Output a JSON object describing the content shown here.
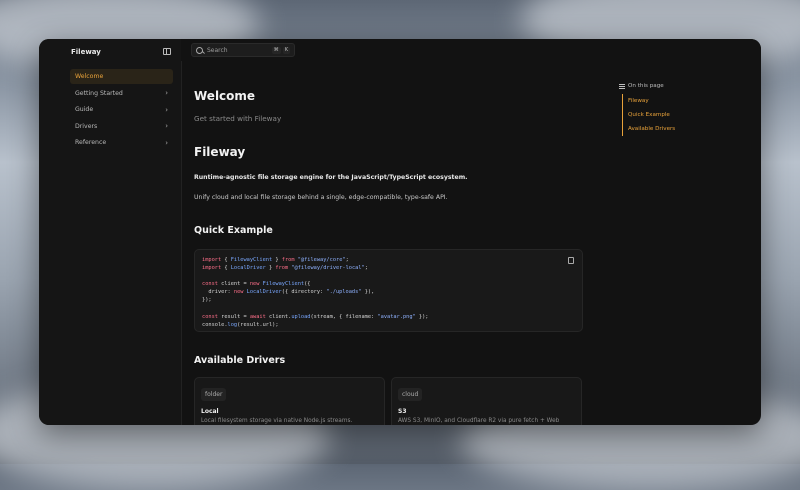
{
  "app": {
    "brand": "Fileway"
  },
  "search": {
    "placeholder": "Search",
    "shortcut": [
      "⌘",
      "K"
    ]
  },
  "sidebar": {
    "items": [
      {
        "label": "Welcome",
        "active": true,
        "expandable": false
      },
      {
        "label": "Getting Started",
        "active": false,
        "expandable": true
      },
      {
        "label": "Guide",
        "active": false,
        "expandable": true
      },
      {
        "label": "Drivers",
        "active": false,
        "expandable": true
      },
      {
        "label": "Reference",
        "active": false,
        "expandable": true
      }
    ]
  },
  "page": {
    "title": "Welcome",
    "subtitle": "Get started with Fileway",
    "heading": "Fileway",
    "lead": "Runtime-agnostic file storage engine for the JavaScript/TypeScript ecosystem.",
    "paragraph": "Unify cloud and local file storage behind a single, edge-compatible, type-safe API.",
    "quick_example_heading": "Quick Example",
    "drivers_heading": "Available Drivers"
  },
  "code_lines": [
    "import { FilewayClient } from \"@fileway/core\";",
    "import { LocalDriver } from \"@fileway/driver-local\";",
    "",
    "const client = new FilewayClient({",
    "  driver: new LocalDriver({ directory: \"./uploads\" }),",
    "});",
    "",
    "const result = await client.upload(stream, { filename: \"avatar.png\" });",
    "console.log(result.url);"
  ],
  "drivers": [
    {
      "tag": "folder",
      "title": "Local",
      "desc": "Local filesystem storage via native Node.js streams."
    },
    {
      "tag": "cloud",
      "title": "S3",
      "desc": "AWS S3, MinIO, and Cloudflare R2 via pure fetch + Web"
    }
  ],
  "toc": {
    "title": "On this page",
    "items": [
      "Fileway",
      "Quick Example",
      "Available Drivers"
    ]
  },
  "colors": {
    "accent": "#e8a23a",
    "background": "#121212"
  }
}
